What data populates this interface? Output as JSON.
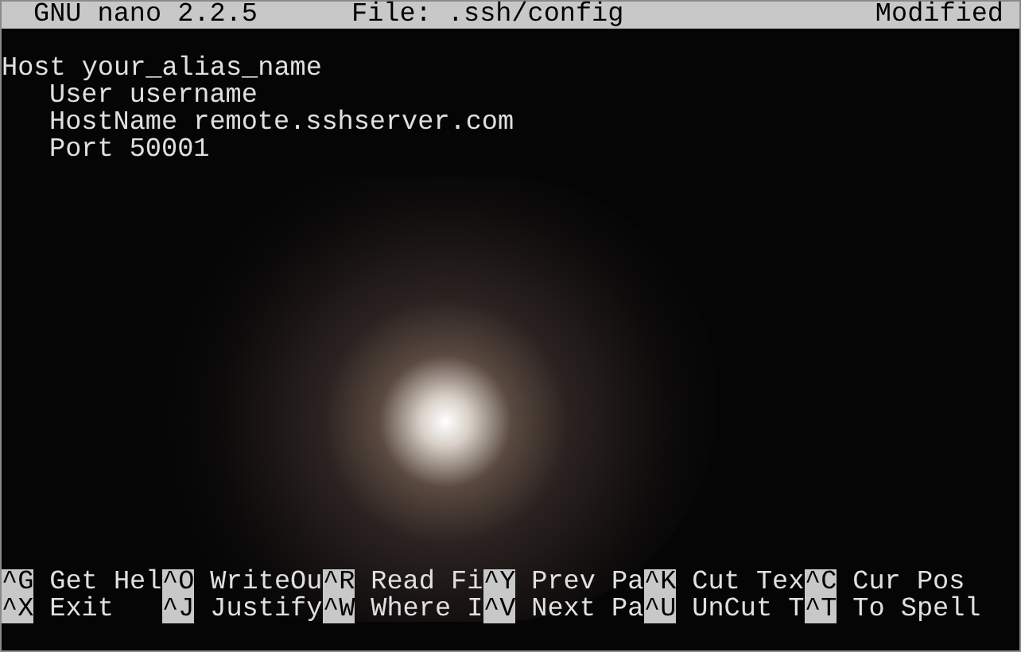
{
  "title_bar": {
    "app": "GNU nano 2.2.5",
    "file": "File: .ssh/config",
    "status": "Modified"
  },
  "editor": {
    "lines": [
      {
        "text": "Host your_alias_name",
        "children": [
          {
            "text": "User username"
          },
          {
            "text": "HostName remote.sshserver.com"
          },
          {
            "text": "Port 50001"
          }
        ]
      }
    ]
  },
  "shortcuts": [
    [
      {
        "key": "^G",
        "label": "Get Hel"
      },
      {
        "key": "^O",
        "label": "WriteOu"
      },
      {
        "key": "^R",
        "label": "Read Fi"
      },
      {
        "key": "^Y",
        "label": "Prev Pa"
      },
      {
        "key": "^K",
        "label": "Cut Tex"
      },
      {
        "key": "^C",
        "label": "Cur Pos"
      }
    ],
    [
      {
        "key": "^X",
        "label": "Exit"
      },
      {
        "key": "^J",
        "label": "Justify"
      },
      {
        "key": "^W",
        "label": "Where I"
      },
      {
        "key": "^V",
        "label": "Next Pa"
      },
      {
        "key": "^U",
        "label": "UnCut T"
      },
      {
        "key": "^T",
        "label": "To Spell"
      }
    ]
  ]
}
